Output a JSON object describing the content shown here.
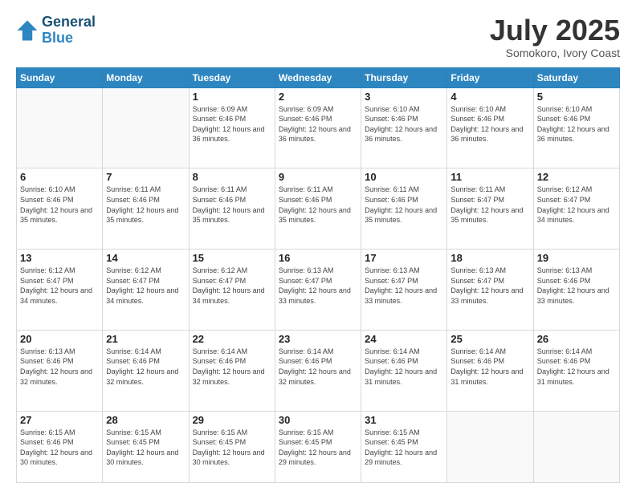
{
  "logo": {
    "line1": "General",
    "line2": "Blue"
  },
  "title": "July 2025",
  "subtitle": "Somokoro, Ivory Coast",
  "days_header": [
    "Sunday",
    "Monday",
    "Tuesday",
    "Wednesday",
    "Thursday",
    "Friday",
    "Saturday"
  ],
  "weeks": [
    [
      {
        "day": "",
        "info": ""
      },
      {
        "day": "",
        "info": ""
      },
      {
        "day": "1",
        "info": "Sunrise: 6:09 AM\nSunset: 6:46 PM\nDaylight: 12 hours and 36 minutes."
      },
      {
        "day": "2",
        "info": "Sunrise: 6:09 AM\nSunset: 6:46 PM\nDaylight: 12 hours and 36 minutes."
      },
      {
        "day": "3",
        "info": "Sunrise: 6:10 AM\nSunset: 6:46 PM\nDaylight: 12 hours and 36 minutes."
      },
      {
        "day": "4",
        "info": "Sunrise: 6:10 AM\nSunset: 6:46 PM\nDaylight: 12 hours and 36 minutes."
      },
      {
        "day": "5",
        "info": "Sunrise: 6:10 AM\nSunset: 6:46 PM\nDaylight: 12 hours and 36 minutes."
      }
    ],
    [
      {
        "day": "6",
        "info": "Sunrise: 6:10 AM\nSunset: 6:46 PM\nDaylight: 12 hours and 35 minutes."
      },
      {
        "day": "7",
        "info": "Sunrise: 6:11 AM\nSunset: 6:46 PM\nDaylight: 12 hours and 35 minutes."
      },
      {
        "day": "8",
        "info": "Sunrise: 6:11 AM\nSunset: 6:46 PM\nDaylight: 12 hours and 35 minutes."
      },
      {
        "day": "9",
        "info": "Sunrise: 6:11 AM\nSunset: 6:46 PM\nDaylight: 12 hours and 35 minutes."
      },
      {
        "day": "10",
        "info": "Sunrise: 6:11 AM\nSunset: 6:46 PM\nDaylight: 12 hours and 35 minutes."
      },
      {
        "day": "11",
        "info": "Sunrise: 6:11 AM\nSunset: 6:47 PM\nDaylight: 12 hours and 35 minutes."
      },
      {
        "day": "12",
        "info": "Sunrise: 6:12 AM\nSunset: 6:47 PM\nDaylight: 12 hours and 34 minutes."
      }
    ],
    [
      {
        "day": "13",
        "info": "Sunrise: 6:12 AM\nSunset: 6:47 PM\nDaylight: 12 hours and 34 minutes."
      },
      {
        "day": "14",
        "info": "Sunrise: 6:12 AM\nSunset: 6:47 PM\nDaylight: 12 hours and 34 minutes."
      },
      {
        "day": "15",
        "info": "Sunrise: 6:12 AM\nSunset: 6:47 PM\nDaylight: 12 hours and 34 minutes."
      },
      {
        "day": "16",
        "info": "Sunrise: 6:13 AM\nSunset: 6:47 PM\nDaylight: 12 hours and 33 minutes."
      },
      {
        "day": "17",
        "info": "Sunrise: 6:13 AM\nSunset: 6:47 PM\nDaylight: 12 hours and 33 minutes."
      },
      {
        "day": "18",
        "info": "Sunrise: 6:13 AM\nSunset: 6:47 PM\nDaylight: 12 hours and 33 minutes."
      },
      {
        "day": "19",
        "info": "Sunrise: 6:13 AM\nSunset: 6:46 PM\nDaylight: 12 hours and 33 minutes."
      }
    ],
    [
      {
        "day": "20",
        "info": "Sunrise: 6:13 AM\nSunset: 6:46 PM\nDaylight: 12 hours and 32 minutes."
      },
      {
        "day": "21",
        "info": "Sunrise: 6:14 AM\nSunset: 6:46 PM\nDaylight: 12 hours and 32 minutes."
      },
      {
        "day": "22",
        "info": "Sunrise: 6:14 AM\nSunset: 6:46 PM\nDaylight: 12 hours and 32 minutes."
      },
      {
        "day": "23",
        "info": "Sunrise: 6:14 AM\nSunset: 6:46 PM\nDaylight: 12 hours and 32 minutes."
      },
      {
        "day": "24",
        "info": "Sunrise: 6:14 AM\nSunset: 6:46 PM\nDaylight: 12 hours and 31 minutes."
      },
      {
        "day": "25",
        "info": "Sunrise: 6:14 AM\nSunset: 6:46 PM\nDaylight: 12 hours and 31 minutes."
      },
      {
        "day": "26",
        "info": "Sunrise: 6:14 AM\nSunset: 6:46 PM\nDaylight: 12 hours and 31 minutes."
      }
    ],
    [
      {
        "day": "27",
        "info": "Sunrise: 6:15 AM\nSunset: 6:46 PM\nDaylight: 12 hours and 30 minutes."
      },
      {
        "day": "28",
        "info": "Sunrise: 6:15 AM\nSunset: 6:45 PM\nDaylight: 12 hours and 30 minutes."
      },
      {
        "day": "29",
        "info": "Sunrise: 6:15 AM\nSunset: 6:45 PM\nDaylight: 12 hours and 30 minutes."
      },
      {
        "day": "30",
        "info": "Sunrise: 6:15 AM\nSunset: 6:45 PM\nDaylight: 12 hours and 29 minutes."
      },
      {
        "day": "31",
        "info": "Sunrise: 6:15 AM\nSunset: 6:45 PM\nDaylight: 12 hours and 29 minutes."
      },
      {
        "day": "",
        "info": ""
      },
      {
        "day": "",
        "info": ""
      }
    ]
  ]
}
